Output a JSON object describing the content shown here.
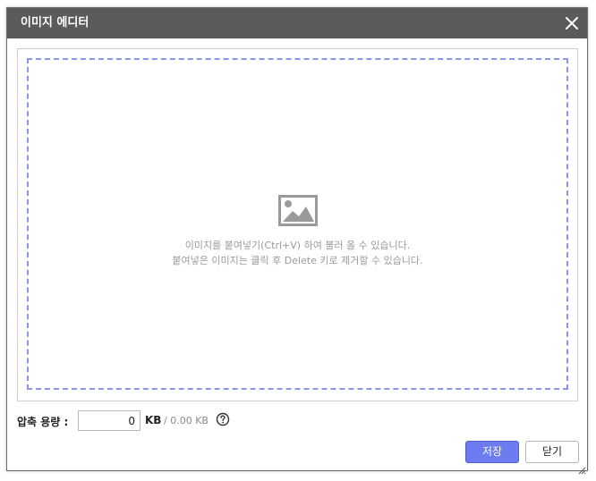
{
  "dialog": {
    "title": "이미지 에디터",
    "close_icon": "close-icon"
  },
  "dropzone": {
    "icon": "image-placeholder-icon",
    "line1": "이미지를 붙여넣기(Ctrl+V) 하여 불러 올 수 있습니다.",
    "line2": "붙여넣은 이미지는 클릭 후 Delete 키로 제거할 수 있습니다."
  },
  "compression": {
    "label": "압축 용량 :",
    "value": "0",
    "unit": "KB",
    "size_info": "/ 0.00 KB",
    "help_icon": "help-circle-icon"
  },
  "buttons": {
    "save_label": "저장",
    "close_label": "닫기"
  },
  "colors": {
    "titlebar": "#5a5a5a",
    "accent": "#6c7cf0",
    "dropzone_border": "#8c96e6"
  }
}
